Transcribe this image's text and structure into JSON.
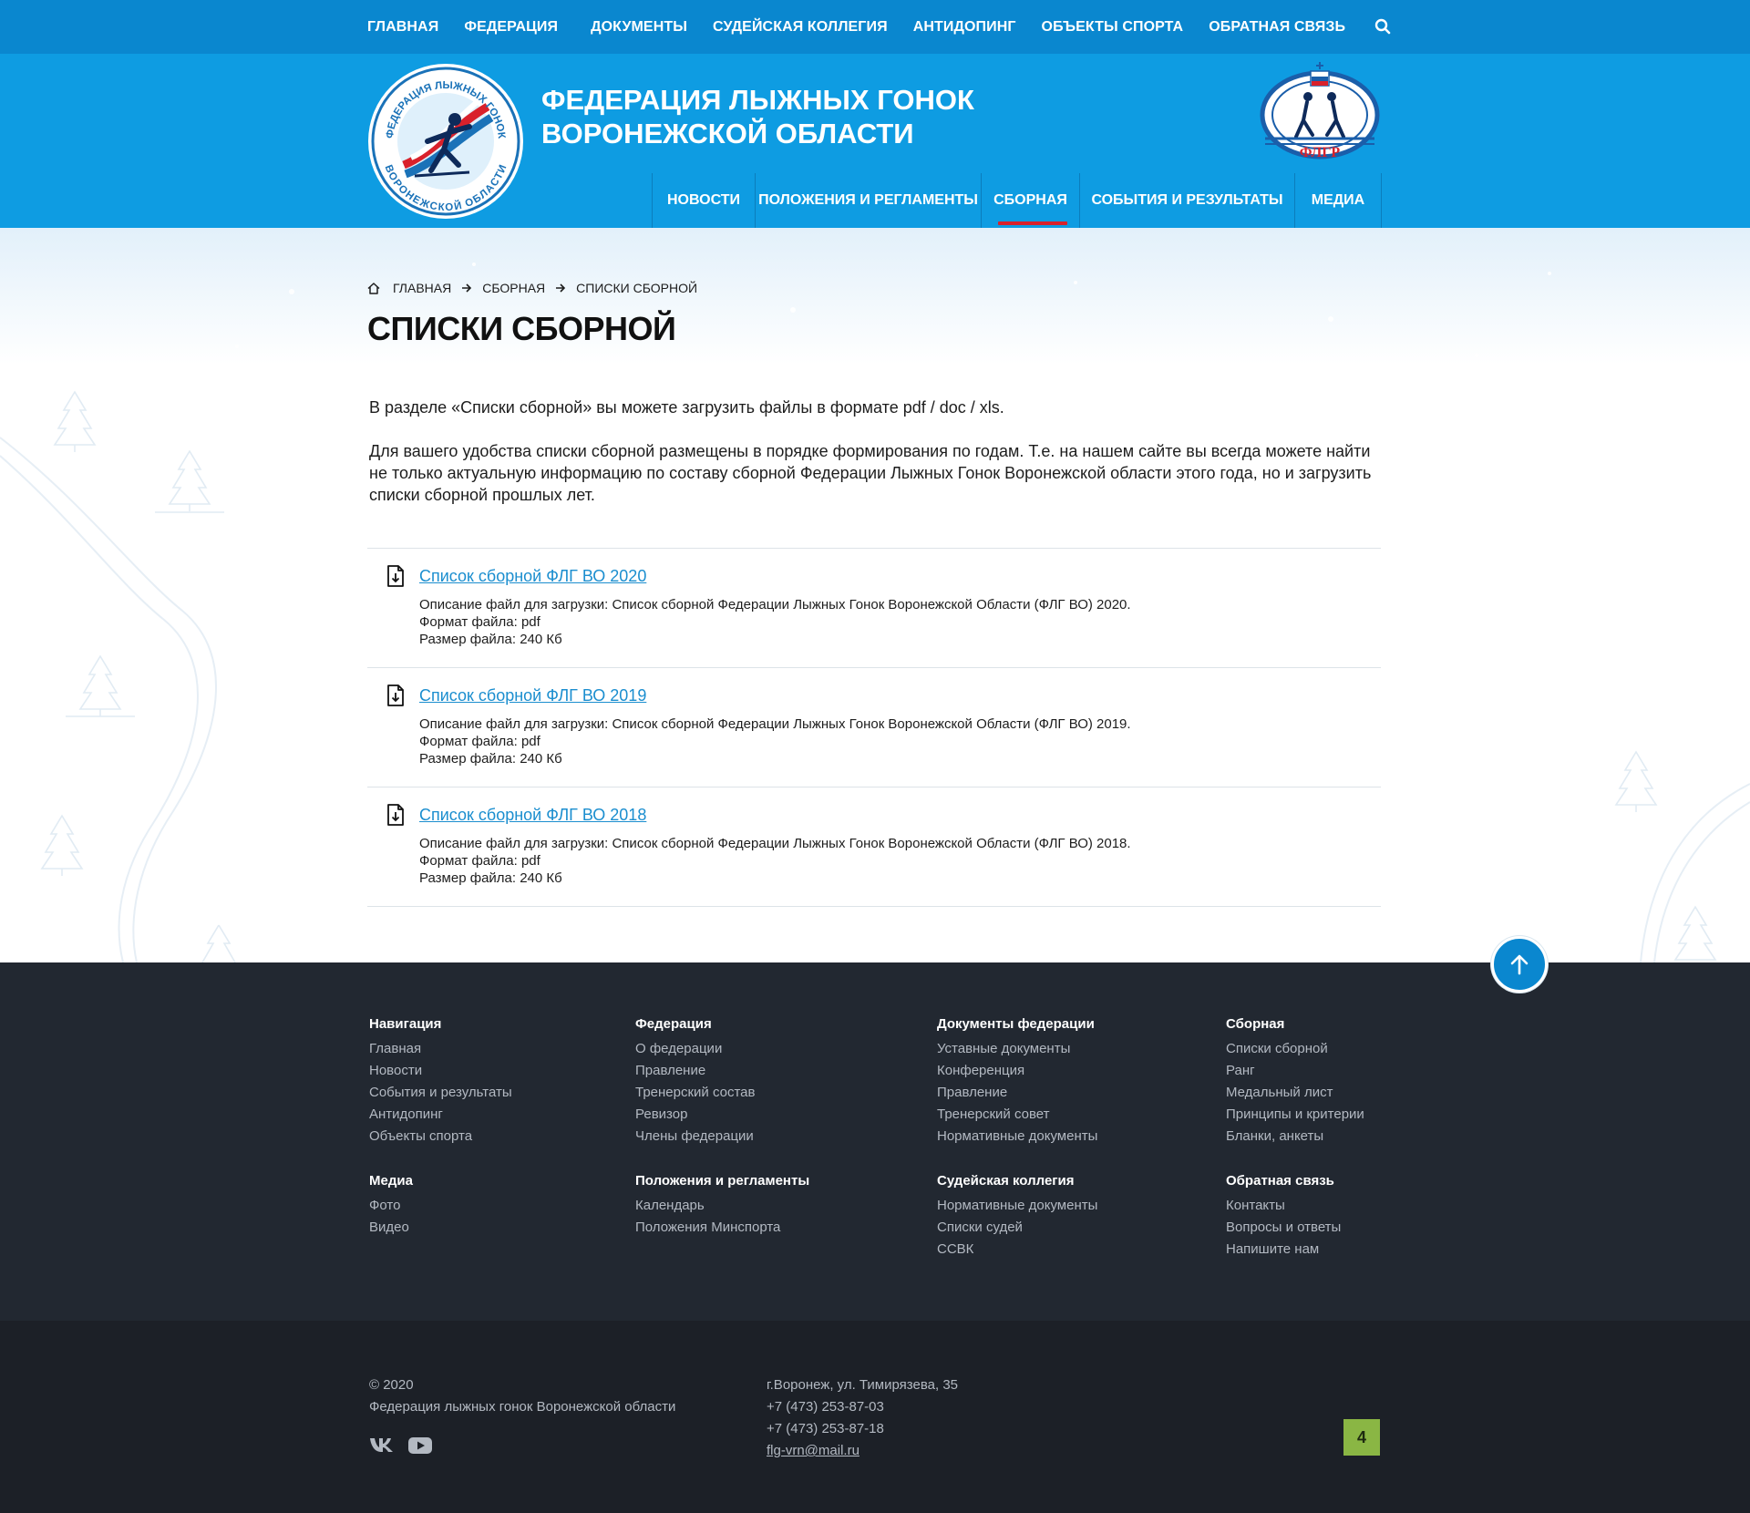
{
  "top_nav": {
    "items": [
      "Главная",
      "Федерация",
      "Документы",
      "Судейская коллегия",
      "Антидопинг",
      "Объекты спорта",
      "Обратная связь"
    ]
  },
  "header": {
    "title_line1": "Федерация лыжных гонок",
    "title_line2": "Воронежской области",
    "logo_text_top": "ФЕДЕРАЦИЯ ЛЫЖНЫХ ГОНОК",
    "logo_text_bottom": "ВОРОНЕЖСКОЙ ОБЛАСТИ",
    "flgr_text": "ФЛГР"
  },
  "main_nav": {
    "items": [
      "Новости",
      "Положения и регламенты",
      "Сборная",
      "События и результаты",
      "Медиа"
    ],
    "active": "Сборная"
  },
  "breadcrumb": [
    "Главная",
    "Сборная",
    "Списки сборной"
  ],
  "page_title": "Списки сборной",
  "intro": {
    "p1": "В разделе «Списки сборной» вы можете загрузить файлы в формате pdf / doc / xls.",
    "p2": "Для вашего удобства списки сборной размещены в порядке формирования по годам. Т.е. на нашем сайте вы всегда можете найти не только актуальную информацию по составу сборной Федерации Лыжных Гонок Воронежской области этого года, но и загрузить списки сборной прошлых лет."
  },
  "files": [
    {
      "title": "Список сборной ФЛГ ВО 2020",
      "description": "Описание файл для загрузки: Список сборной Федерации Лыжных Гонок Воронежской Области (ФЛГ ВО) 2020.",
      "format": "Формат файла: pdf",
      "size": "Размер файла: 240 Кб"
    },
    {
      "title": "Список сборной ФЛГ ВО 2019",
      "description": "Описание файл для загрузки: Список сборной Федерации Лыжных Гонок Воронежской Области (ФЛГ ВО) 2019.",
      "format": "Формат файла: pdf",
      "size": "Размер файла: 240 Кб"
    },
    {
      "title": "Список сборной ФЛГ ВО 2018",
      "description": "Описание файл для загрузки: Список сборной Федерации Лыжных Гонок Воронежской Области (ФЛГ ВО) 2018.",
      "format": "Формат файла: pdf",
      "size": "Размер файла: 240 Кб"
    }
  ],
  "footer": {
    "columns": [
      {
        "title": "Навигация",
        "links": [
          "Главная",
          "Новости",
          "События и результаты",
          "Антидопинг",
          "Объекты спорта"
        ]
      },
      {
        "title": "Федерация",
        "links": [
          "О федерации",
          "Правление",
          "Тренерский состав",
          "Ревизор",
          "Члены федерации"
        ]
      },
      {
        "title": "Документы федерации",
        "links": [
          "Уставные документы",
          "Конференция",
          "Правление",
          "Тренерский совет",
          "Нормативные документы"
        ]
      },
      {
        "title": "Сборная",
        "links": [
          "Списки сборной",
          "Ранг",
          "Медальный лист",
          "Принципы и критерии",
          "Бланки, анкеты"
        ]
      },
      {
        "title": "Медиа",
        "links": [
          "Фото",
          "Видео"
        ]
      },
      {
        "title": "Положения и регламенты",
        "links": [
          "Календарь",
          "Положения Минспорта"
        ]
      },
      {
        "title": "Судейская коллегия",
        "links": [
          "Нормативные документы",
          "Списки судей",
          "СCВК"
        ]
      },
      {
        "title": "Обратная связь",
        "links": [
          "Контакты",
          "Вопросы и ответы",
          "Напишите нам"
        ]
      }
    ]
  },
  "bottom": {
    "copyright": "© 2020",
    "org": "Федерация лыжных гонок Воронежской области",
    "address": "г.Воронеж, ул. Тимирязева, 35",
    "phone1": "+7 (473) 253-87-03",
    "phone2": "+7 (473) 253-87-18",
    "email": "flg-vrn@mail.ru",
    "counter": "4"
  },
  "colors": {
    "topbar": "#0a87cf",
    "header": "#0e9ce2",
    "accent_red": "#d9212b",
    "link": "#1b8ecf",
    "footer": "#222831",
    "bottom": "#1c2027",
    "counter": "#8ab644"
  },
  "icons": [
    "search-icon",
    "home-icon",
    "arrow-right-icon",
    "file-download-icon",
    "arrow-up-icon",
    "vk-icon",
    "youtube-icon"
  ]
}
